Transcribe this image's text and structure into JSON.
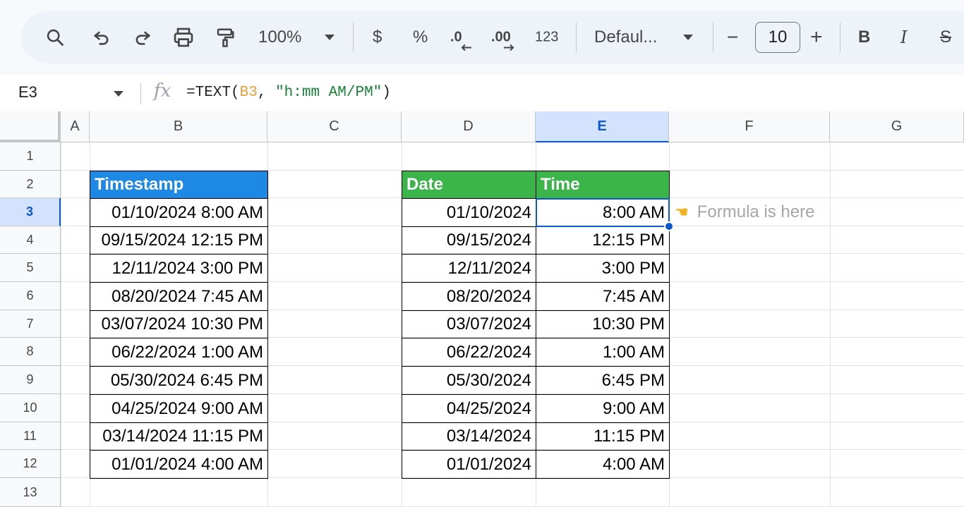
{
  "toolbar": {
    "zoom": "100%",
    "currency": "$",
    "percent": "%",
    "decrease_decimal": ".0",
    "increase_decimal": ".00",
    "number_format": "123",
    "font": "Defaul...",
    "font_size": "10",
    "minus": "−",
    "plus": "+",
    "bold": "B",
    "italic": "I",
    "strike": "S"
  },
  "formula_bar": {
    "cell_ref": "E3",
    "fx": "fx",
    "formula_prefix": "=TEXT(",
    "formula_ref": "B3",
    "formula_mid": ", ",
    "formula_string": "\"h:mm AM/PM\"",
    "formula_suffix": ")"
  },
  "columns": [
    "A",
    "B",
    "C",
    "D",
    "E",
    "F",
    "G"
  ],
  "rows": [
    "1",
    "2",
    "3",
    "4",
    "5",
    "6",
    "7",
    "8",
    "9",
    "10",
    "11",
    "12",
    "13"
  ],
  "selected": {
    "column": "E",
    "row": "3"
  },
  "table_timestamp": {
    "header": "Timestamp",
    "header_color": "#1e88e5",
    "values": [
      "01/10/2024 8:00 AM",
      "09/15/2024 12:15 PM",
      "12/11/2024 3:00 PM",
      "08/20/2024 7:45 AM",
      "03/07/2024 10:30 PM",
      "06/22/2024 1:00 AM",
      "05/30/2024 6:45 PM",
      "04/25/2024 9:00 AM",
      "03/14/2024 11:15 PM",
      "01/01/2024 4:00 AM"
    ]
  },
  "table_split": {
    "header_color": "#3bb54a",
    "date_header": "Date",
    "time_header": "Time",
    "dates": [
      "01/10/2024",
      "09/15/2024",
      "12/11/2024",
      "08/20/2024",
      "03/07/2024",
      "06/22/2024",
      "05/30/2024",
      "04/25/2024",
      "03/14/2024",
      "01/01/2024"
    ],
    "times": [
      "8:00 AM",
      "12:15 PM",
      "3:00 PM",
      "7:45 AM",
      "10:30 PM",
      "1:00 AM",
      "6:45 PM",
      "9:00 AM",
      "11:15 PM",
      "4:00 AM"
    ]
  },
  "annotation": {
    "icon": "pointing-hand-icon",
    "text": "Formula is here"
  }
}
